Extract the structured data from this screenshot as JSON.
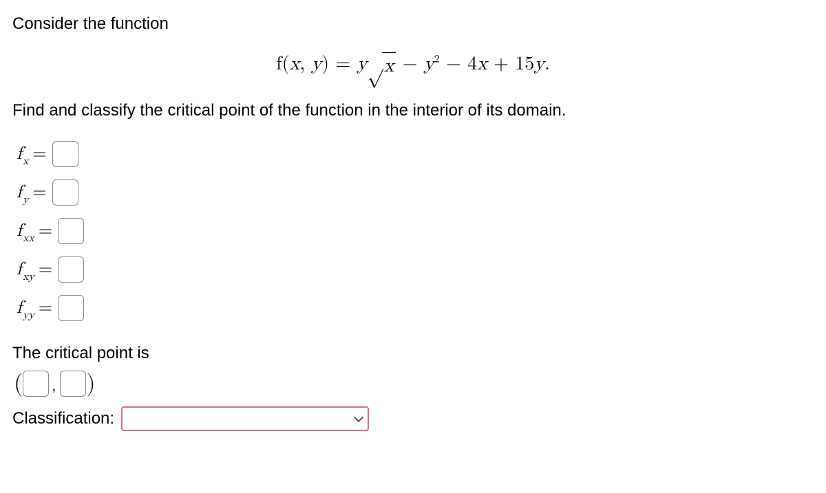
{
  "prompt_intro": "Consider the function",
  "equation_parts": {
    "lhs_f": "f",
    "lhs_open": "(",
    "lhs_x": "x",
    "lhs_comma": ", ",
    "lhs_y": "y",
    "lhs_close": ") ",
    "eq": "= ",
    "t1_y": "y",
    "t1_sqrt": "√",
    "t1_rad": "x",
    "minus1": " − ",
    "t2_y": "y",
    "t2_exp": "2",
    "minus2": " − ",
    "t3_coef": "4",
    "t3_var": "x",
    "plus": " + ",
    "t4_coef": "15",
    "t4_var": "y",
    "period": "."
  },
  "instruction": "Find and classify the critical point of the function in the interior of its domain.",
  "deriv_labels": {
    "fx_main": "f",
    "fx_sub": "x",
    "fy_main": "f",
    "fy_sub": "y",
    "fxx_main": "f",
    "fxx_sub": "xx",
    "fxy_main": "f",
    "fxy_sub": "xy",
    "fyy_main": "f",
    "fyy_sub": "yy",
    "eq": "="
  },
  "critical_point_header": "The critical point is",
  "paren_open": "(",
  "paren_close": ")",
  "comma": ",",
  "classification_label": "Classification:",
  "classification_options": [
    ""
  ]
}
